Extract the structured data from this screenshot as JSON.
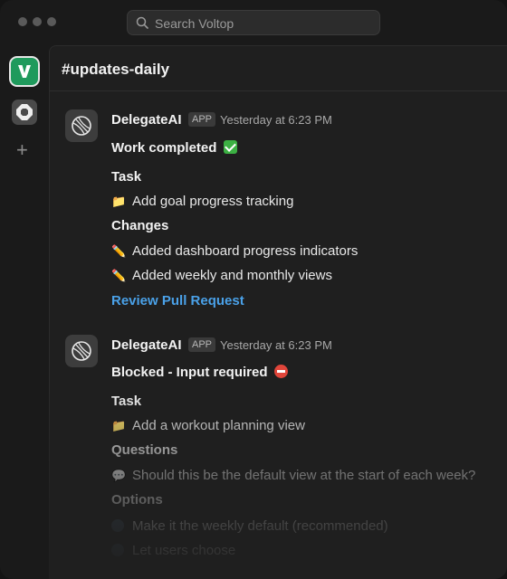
{
  "search": {
    "placeholder": "Search Voltop"
  },
  "channel": {
    "title": "#updates-daily"
  },
  "messages": [
    {
      "sender": "DelegateAI",
      "badge": "APP",
      "time": "Yesterday at 6:23 PM",
      "headline": "Work completed",
      "headline_icon": "check-mark-emoji",
      "task_heading": "Task",
      "task": "Add goal progress tracking",
      "changes_heading": "Changes",
      "changes": [
        "Added dashboard progress indicators",
        "Added weekly and monthly views"
      ],
      "link": "Review Pull Request"
    },
    {
      "sender": "DelegateAI",
      "badge": "APP",
      "time": "Yesterday at 6:23 PM",
      "headline": "Blocked - Input required",
      "headline_icon": "no-entry-emoji",
      "task_heading": "Task",
      "task": "Add a workout planning view",
      "questions_heading": "Questions",
      "question": "Should this be the default view at the start of each week?",
      "options_heading": "Options",
      "options": [
        "Make it the weekly default (recommended)",
        "Let users choose"
      ]
    }
  ],
  "icons": {
    "workspace": "voltop-logo",
    "workspace_secondary": "octagon-workspace-icon",
    "add": "plus-icon",
    "folder": "folder-emoji",
    "pencil": "pencil-emoji",
    "question": "speech-bubble-emoji"
  },
  "colors": {
    "link": "#4aa1e8",
    "workspace_accent": "#1f9a5c",
    "check": "#3cb043",
    "no_entry": "#e0453a"
  }
}
